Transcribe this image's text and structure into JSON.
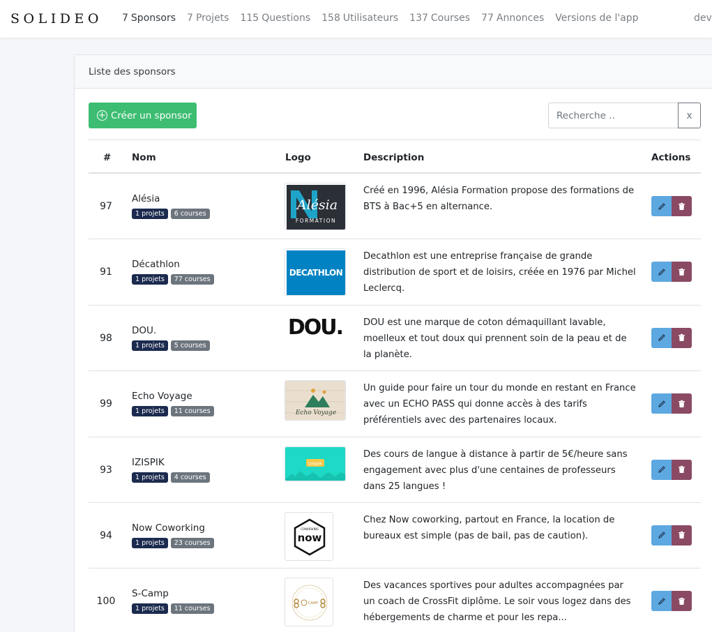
{
  "brand": "SOLIDEO",
  "nav": [
    {
      "num": "7",
      "label": "Sponsors",
      "active": true
    },
    {
      "num": "7",
      "label": "Projets"
    },
    {
      "num": "115",
      "label": "Questions"
    },
    {
      "num": "158",
      "label": "Utilisateurs"
    },
    {
      "num": "137",
      "label": "Courses"
    },
    {
      "num": "77",
      "label": "Annonces"
    },
    {
      "num": "",
      "label": "Versions de l'app"
    }
  ],
  "nav_right": "dev",
  "card": {
    "title": "Liste des sponsors",
    "create_label": "Créer un sponsor",
    "search_placeholder": "Recherche ..",
    "clear_label": "x"
  },
  "table": {
    "headers": [
      "#",
      "Nom",
      "Logo",
      "Description",
      "Actions"
    ],
    "rows": [
      {
        "id": "97",
        "name": "Alésia",
        "projects": "1 projets",
        "courses": "6 courses",
        "logo": "alesia-formation-logo",
        "description": "Créé en 1996, Alésia Formation propose des formations de BTS à Bac+5 en alternance."
      },
      {
        "id": "91",
        "name": "Décathlon",
        "projects": "1 projets",
        "courses": "77 courses",
        "logo": "decathlon-logo",
        "description": "Decathlon est une entreprise française de grande distribution de sport et de loisirs, créée en 1976 par Michel Leclercq."
      },
      {
        "id": "98",
        "name": "DOU.",
        "projects": "1 projets",
        "courses": "5 courses",
        "logo": "dou-logo",
        "description": "DOU est une marque de coton démaquillant lavable, moelleux et tout doux qui prennent soin de la peau et de la planète."
      },
      {
        "id": "99",
        "name": "Echo Voyage",
        "projects": "1 projets",
        "courses": "11 courses",
        "logo": "echo-voyage-logo",
        "description": "Un guide pour faire un tour du monde en restant en France avec un ECHO PASS qui donne accès à des tarifs préférentiels avec des partenaires locaux."
      },
      {
        "id": "93",
        "name": "IZISPIK",
        "projects": "1 projets",
        "courses": "4 courses",
        "logo": "izispik-logo",
        "description": "Des cours de langue à distance à partir de 5€/heure sans engagement avec plus d'une centaines de professeurs dans 25 langues !"
      },
      {
        "id": "94",
        "name": "Now Coworking",
        "projects": "1 projets",
        "courses": "23 courses",
        "logo": "now-coworking-logo",
        "description": "Chez Now coworking, partout en France, la location de bureaux est simple (pas de bail, pas de caution)."
      },
      {
        "id": "100",
        "name": "S-Camp",
        "projects": "1 projets",
        "courses": "11 courses",
        "logo": "s-camp-logo",
        "description": "Des vacances sportives pour adultes accompagnées par un coach de CrossFit diplôme. Le soir vous logez dans des hébergements de charme et pour les repa..."
      }
    ]
  },
  "colors": {
    "create_button": "#3dbd72",
    "edit_button": "#5da8e0",
    "delete_button": "#8a4a63",
    "badge_projects": "#1b2a4e",
    "badge_courses": "#6c757d"
  },
  "logo_text": {
    "alesia_main": "Alésia",
    "alesia_sub": "FORMATION",
    "decathlon": "DECATHLON",
    "dou": "DOU.",
    "echo": "Echo Voyage",
    "izispik": "izispik",
    "now": "now",
    "now_top": "COWORKING",
    "scamp": "CAMP"
  }
}
